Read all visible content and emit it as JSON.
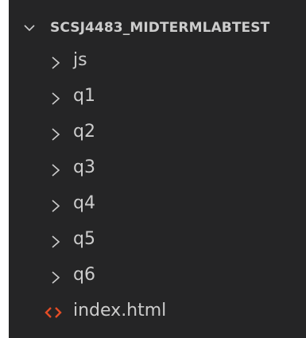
{
  "explorer": {
    "project_title": "SCSJ4483_MIDTERMLABTEST",
    "folders": [
      {
        "label": "js"
      },
      {
        "label": "q1"
      },
      {
        "label": "q2"
      },
      {
        "label": "q3"
      },
      {
        "label": "q4"
      },
      {
        "label": "q5"
      },
      {
        "label": "q6"
      }
    ],
    "files": [
      {
        "label": "index.html",
        "icon": "html-file-icon",
        "icon_color": "#e44d26"
      }
    ]
  },
  "colors": {
    "background": "#252526",
    "text": "#cccccc",
    "html_icon": "#e44d26"
  }
}
